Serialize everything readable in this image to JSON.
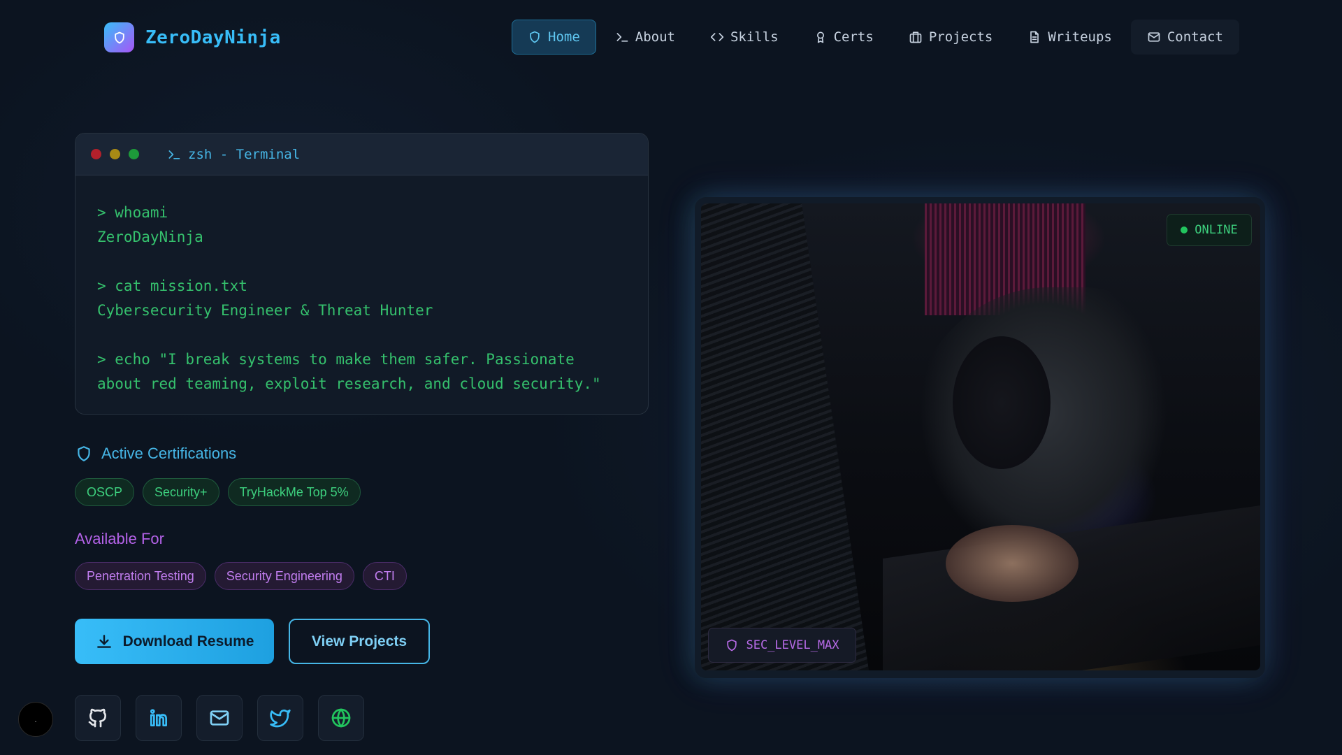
{
  "brand": {
    "name": "ZeroDayNinja",
    "logo_icon": "shield-icon"
  },
  "nav": {
    "items": [
      {
        "label": "Home",
        "icon": "shield-icon",
        "active": true
      },
      {
        "label": "About",
        "icon": "terminal-icon",
        "active": false
      },
      {
        "label": "Skills",
        "icon": "code-icon",
        "active": false
      },
      {
        "label": "Certs",
        "icon": "award-icon",
        "active": false
      },
      {
        "label": "Projects",
        "icon": "briefcase-icon",
        "active": false
      },
      {
        "label": "Writeups",
        "icon": "file-text-icon",
        "active": false
      },
      {
        "label": "Contact",
        "icon": "mail-icon",
        "active": false
      }
    ]
  },
  "terminal": {
    "title": "zsh - Terminal",
    "lines": [
      "> whoami",
      "ZeroDayNinja",
      "",
      "> cat mission.txt",
      "Cybersecurity Engineer & Threat Hunter",
      "",
      "> echo \"I break systems to make them safer. Passionate",
      "about red teaming, exploit research, and cloud security.\""
    ]
  },
  "certifications": {
    "heading": "Active Certifications",
    "items": [
      "OSCP",
      "Security+",
      "TryHackMe Top 5%"
    ]
  },
  "available": {
    "heading": "Available For",
    "items": [
      "Penetration Testing",
      "Security Engineering",
      "CTI"
    ]
  },
  "actions": {
    "download_label": "Download Resume",
    "projects_label": "View Projects"
  },
  "socials": [
    {
      "name": "github-icon",
      "color": "#e5e7eb"
    },
    {
      "name": "linkedin-icon",
      "color": "#38bdf8"
    },
    {
      "name": "mail-icon",
      "color": "#7fd0f5"
    },
    {
      "name": "twitter-icon",
      "color": "#38bdf8"
    },
    {
      "name": "globe-icon",
      "color": "#22c55e"
    }
  ],
  "bottom_badge": ".",
  "image_panel": {
    "status": "ONLINE",
    "badge": "SEC_LEVEL_MAX"
  },
  "colors": {
    "accent": "#38bdf8",
    "green": "#3dd07e",
    "purple": "#b462e8",
    "background": "#0c1420"
  }
}
